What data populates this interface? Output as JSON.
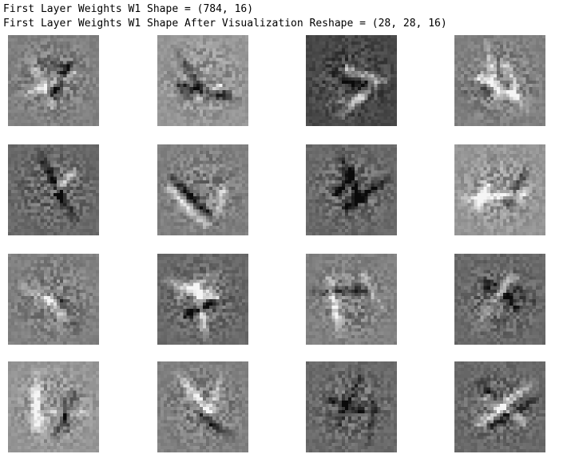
{
  "output": {
    "lines": [
      "First Layer Weights W1 Shape = (784, 16)",
      "First Layer Weights W1 Shape After Visualization Reshape = (28, 28, 16)"
    ]
  },
  "figure": {
    "rows": 4,
    "cols": 4,
    "colormap": "gray",
    "image_shape": [
      28,
      28
    ],
    "panels": [
      {
        "tone": "medium"
      },
      {
        "tone": "medium-light"
      },
      {
        "tone": "dark"
      },
      {
        "tone": "medium"
      },
      {
        "tone": "medium-dark"
      },
      {
        "tone": "medium"
      },
      {
        "tone": "medium-dark"
      },
      {
        "tone": "medium-light"
      },
      {
        "tone": "medium"
      },
      {
        "tone": "medium-dark"
      },
      {
        "tone": "medium"
      },
      {
        "tone": "medium-dark"
      },
      {
        "tone": "medium-light"
      },
      {
        "tone": "medium"
      },
      {
        "tone": "medium-dark"
      },
      {
        "tone": "medium-dark"
      }
    ]
  }
}
